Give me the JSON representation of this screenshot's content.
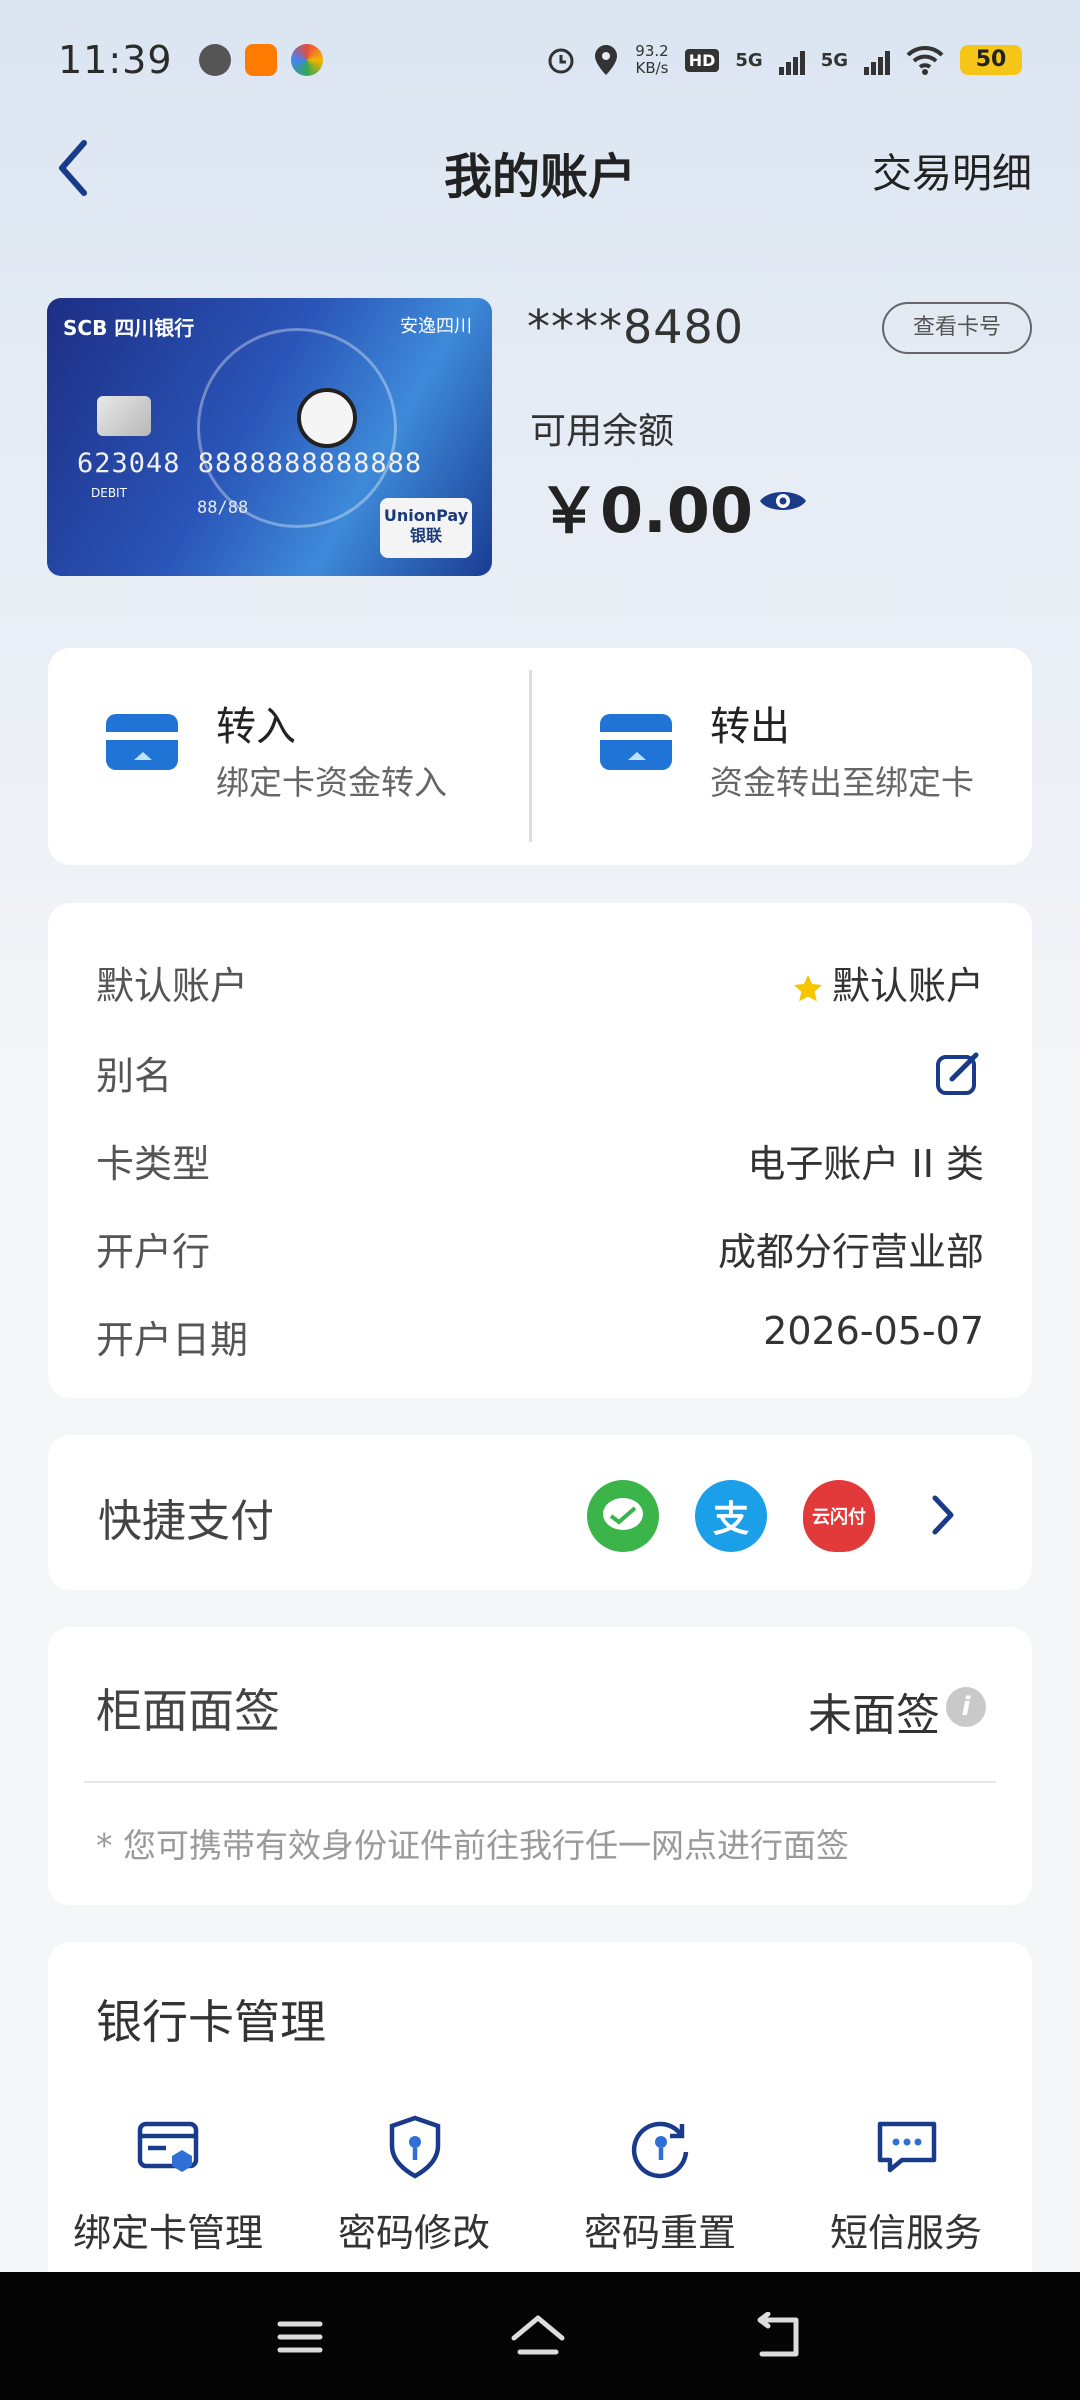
{
  "status": {
    "time": "11:39",
    "net_speed_value": "93.2",
    "net_speed_unit": "KB/s",
    "battery": "50",
    "network1": "5G",
    "network2": "5G"
  },
  "nav": {
    "title": "我的账户",
    "right_link": "交易明细"
  },
  "card": {
    "bank_logo": "SCB 四川银行",
    "card_number": "623048 8888888888888",
    "debit": "DEBIT",
    "thru": "88/88",
    "unionpay": "UnionPay 银联",
    "emblem": "安逸四川"
  },
  "account": {
    "masked_number": "****8480",
    "view_card_button": "查看卡号",
    "balance_label": "可用余额",
    "balance_value": "￥0.00"
  },
  "transfer": {
    "in": {
      "title": "转入",
      "subtitle": "绑定卡资金转入"
    },
    "out": {
      "title": "转出",
      "subtitle": "资金转出至绑定卡"
    }
  },
  "info": {
    "rows": [
      {
        "label": "默认账户",
        "value": "默认账户"
      },
      {
        "label": "别名",
        "value": ""
      },
      {
        "label": "卡类型",
        "value": "电子账户 II 类"
      },
      {
        "label": "开户行",
        "value": "成都分行营业部"
      },
      {
        "label": "开户日期",
        "value": "2026-05-07"
      }
    ]
  },
  "quickpay": {
    "label": "快捷支付",
    "channels": [
      {
        "name": "wechat-pay",
        "color": "#3bb44a"
      },
      {
        "name": "alipay",
        "color": "#1a9fe8",
        "glyph": "支"
      },
      {
        "name": "unionpay-cloud",
        "color": "#e23a3a",
        "glyph": "云闪付"
      }
    ]
  },
  "face_sign": {
    "label": "柜面面签",
    "value": "未面签",
    "note": "* 您可携带有效身份证件前往我行任一网点进行面签"
  },
  "management": {
    "title": "银行卡管理",
    "items": [
      {
        "label": "绑定卡管理",
        "icon": "bind-card-icon"
      },
      {
        "label": "密码修改",
        "icon": "shield-key-icon"
      },
      {
        "label": "密码重置",
        "icon": "reset-key-icon"
      },
      {
        "label": "短信服务",
        "icon": "sms-icon"
      }
    ]
  },
  "colors": {
    "primary_blue": "#1f74d6",
    "icon_navy": "#1a3a8a",
    "star_yellow": "#f7c600"
  }
}
